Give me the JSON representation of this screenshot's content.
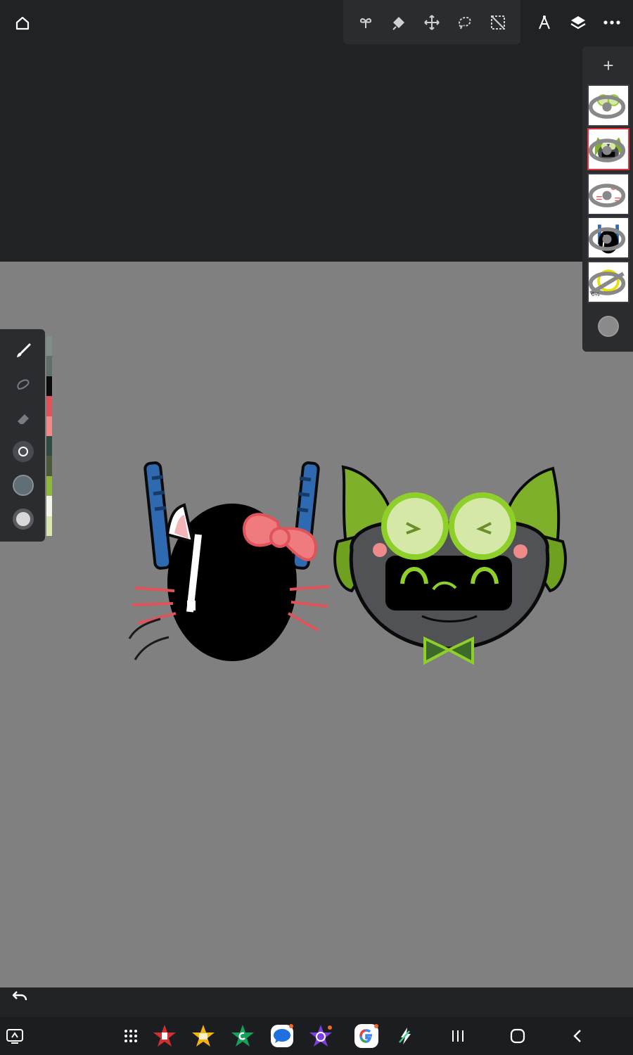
{
  "toolbar": {
    "home_icon": "home-icon",
    "tools": [
      "adjustments-icon",
      "selection-fill-icon",
      "move-icon",
      "lasso-icon",
      "transform-icon"
    ],
    "right": [
      "ruler-icon",
      "layers-icon",
      "more-icon"
    ]
  },
  "layers_panel": {
    "add_label": "+",
    "layers": [
      {
        "name": "goggles-layer",
        "visible": true,
        "active": false,
        "opacity_label": ""
      },
      {
        "name": "green-cat-layer",
        "visible": true,
        "active": true,
        "opacity_label": ""
      },
      {
        "name": "bow-whiskers-layer",
        "visible": true,
        "active": false,
        "opacity_label": ""
      },
      {
        "name": "helmet-layer",
        "visible": true,
        "active": false,
        "opacity_label": ""
      },
      {
        "name": "glow-ring-layer",
        "visible": false,
        "active": false,
        "opacity_label": "0%"
      }
    ]
  },
  "left_tools": [
    "brush-icon",
    "smudge-icon",
    "eraser-icon",
    "brush-size-icon",
    "color-swatch-icon",
    "opacity-icon"
  ],
  "palette_colors": [
    "#7d8f8a",
    "#5f6f6b",
    "#0a0a0a",
    "#e0535a",
    "#f08a8a",
    "#2f4a40",
    "#4a5a3a",
    "#8fb83a",
    "#f2f5ea",
    "#d8e6b0"
  ],
  "canvas": {
    "background": "#808080"
  },
  "nav": {
    "apps": [
      "app-drawer-icon",
      "red-star-app-icon",
      "yellow-star-app-icon",
      "green-star-app-icon",
      "messages-app-icon",
      "purple-star-app-icon",
      "google-app-icon",
      "flash-app-icon"
    ],
    "system": [
      "recents-icon",
      "home-nav-icon",
      "back-icon"
    ]
  }
}
